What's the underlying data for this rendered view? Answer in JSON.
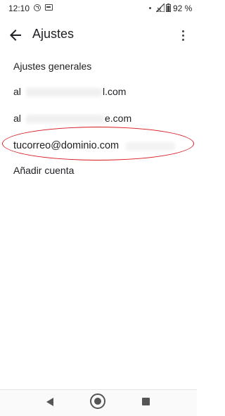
{
  "status_bar": {
    "time": "12:10",
    "battery": "92 %",
    "icons": [
      "notification-circle-icon",
      "sim-icon",
      "dot-icon",
      "signal-icon",
      "battery-icon"
    ]
  },
  "app_bar": {
    "title": "Ajustes",
    "back_icon": "arrow-back-icon",
    "overflow_icon": "more-vert-icon"
  },
  "settings": {
    "general": "Ajustes generales",
    "account1": {
      "start": "al",
      "end": "l.com"
    },
    "account2": {
      "start": "al",
      "end": "e.com"
    },
    "account3": "tucorreo@dominio.com",
    "add_account": "Añadir cuenta"
  },
  "colors": {
    "highlight": "#d71920"
  },
  "nav_bar": {
    "icons": [
      "nav-back-icon",
      "nav-home-icon",
      "nav-recents-icon"
    ]
  }
}
